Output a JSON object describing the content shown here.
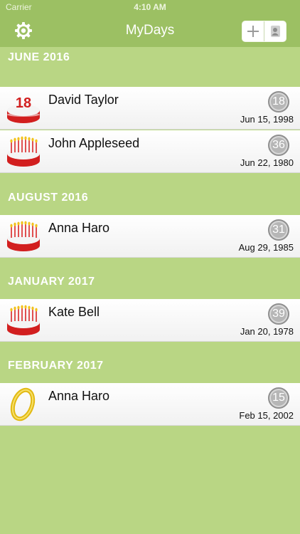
{
  "status": {
    "carrier": "Carrier",
    "time": "4:10 AM"
  },
  "nav": {
    "title": "MyDays"
  },
  "colors": {
    "nav_bg": "#9cc063",
    "page_bg": "#b9d684",
    "age_badge": "#b6b6b6"
  },
  "icons": {
    "settings": "gear-icon",
    "add": "plus-icon",
    "contacts": "contact-card-icon"
  },
  "sections": [
    {
      "header": "JUNE 2016",
      "rows": [
        {
          "name": "David Taylor",
          "age": "18",
          "date": "Jun 15, 1998",
          "icon": "birthday-cake-18-icon"
        },
        {
          "name": "John Appleseed",
          "age": "36",
          "date": "Jun 22, 1980",
          "icon": "birthday-cake-icon"
        }
      ]
    },
    {
      "header": "AUGUST 2016",
      "rows": [
        {
          "name": "Anna Haro",
          "age": "31",
          "date": "Aug 29, 1985",
          "icon": "birthday-cake-icon"
        }
      ]
    },
    {
      "header": "JANUARY 2017",
      "rows": [
        {
          "name": "Kate Bell",
          "age": "39",
          "date": "Jan 20, 1978",
          "icon": "birthday-cake-icon"
        }
      ]
    },
    {
      "header": "FEBRUARY 2017",
      "rows": [
        {
          "name": "Anna Haro",
          "age": "15",
          "date": "Feb 15, 2002",
          "icon": "wedding-ring-icon"
        }
      ]
    }
  ]
}
